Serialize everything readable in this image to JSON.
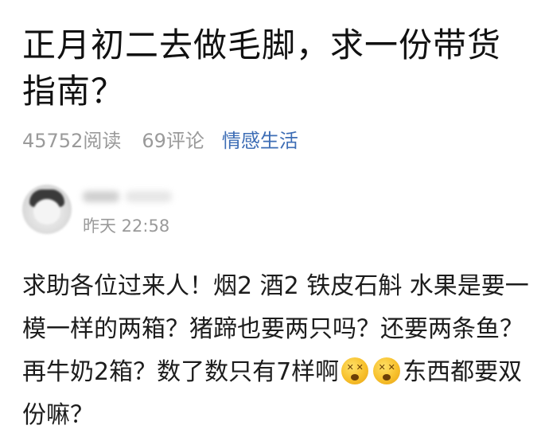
{
  "post": {
    "title": "正月初二去做毛脚，求一份带货指南？",
    "reads": "45752阅读",
    "comments": "69评论",
    "category": "情感生活"
  },
  "author": {
    "time": "昨天 22:58"
  },
  "content": {
    "part1": "求助各位过来人！烟2 酒2 铁皮石斛 水果是要一模一样的两箱？猪蹄也要两只吗？还要两条鱼？再牛奶2箱？数了数只有7样啊",
    "part2": "东西都要双份嘛？",
    "emoji_name": "dizzy-face-emoji"
  }
}
